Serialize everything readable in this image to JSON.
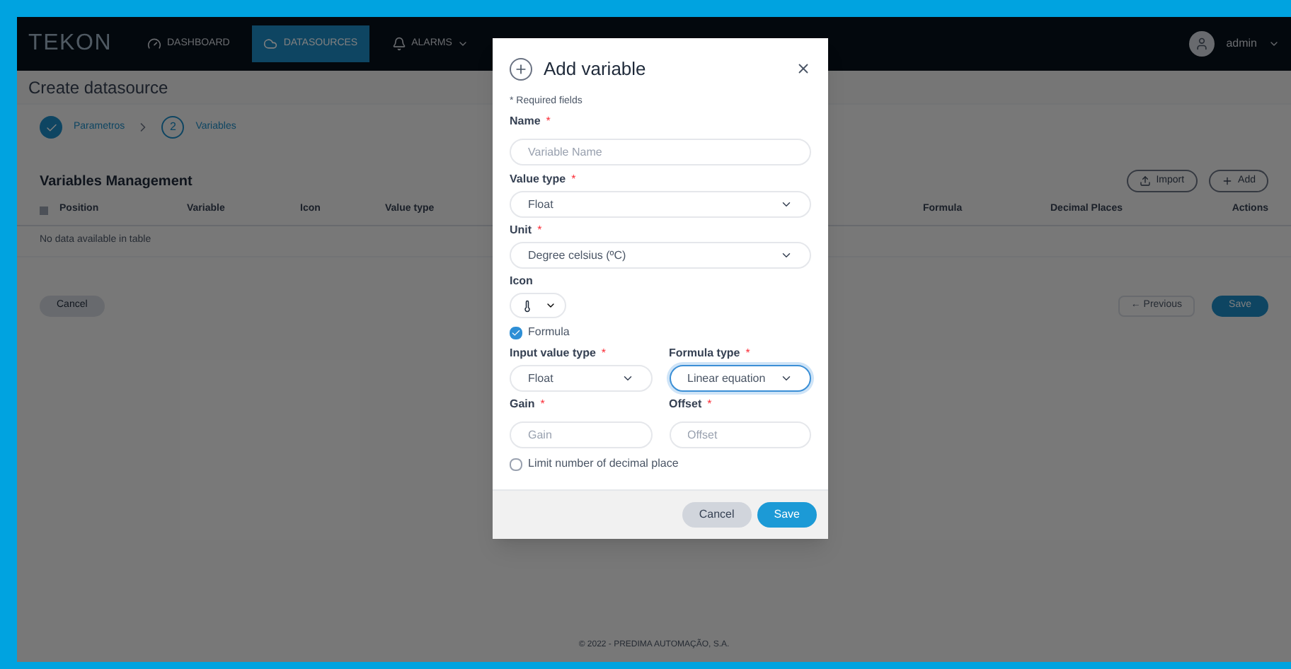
{
  "navbar": {
    "logo": "TEKON",
    "tabs": [
      {
        "label": "DASHBOARD",
        "selected": false,
        "dropdown": false
      },
      {
        "label": "DATASOURCES",
        "selected": true,
        "dropdown": false
      },
      {
        "label": "ALARMS",
        "selected": false,
        "dropdown": true
      }
    ],
    "user": "admin"
  },
  "page": {
    "title": "Create datasource",
    "steps": [
      {
        "label": "Parametros",
        "done": true
      },
      {
        "label": "Variables",
        "number": "2",
        "done": false
      }
    ],
    "section_title": "Variables Management",
    "actions": [
      {
        "label": "Import"
      },
      {
        "label": "Add"
      }
    ],
    "table": {
      "columns": [
        "Position",
        "Variable",
        "Icon",
        "Value type",
        "Formula",
        "Decimal Places",
        "Actions"
      ],
      "empty_text": "No data available in table"
    },
    "cancel": "Cancel",
    "previous": "← Previous",
    "save": "Save"
  },
  "footer": "© 2022 - PREDIMA AUTOMAÇÃO, S.A.",
  "modal": {
    "title": "Add variable",
    "required_note": "* Required fields",
    "name": {
      "label": "Name",
      "mark": "*",
      "placeholder": "Variable Name"
    },
    "value_type": {
      "label": "Value type",
      "mark": "*",
      "value": "Float",
      "focused": false
    },
    "unit": {
      "label": "Unit",
      "mark": "*",
      "value": "Degree celsius (ºC)",
      "focused": false
    },
    "icon": {
      "label": "Icon"
    },
    "formula": {
      "label": "Formula",
      "checked": true
    },
    "input_value_type": {
      "label": "Input value type",
      "mark": "*",
      "value": "Float",
      "focused": false
    },
    "formula_type": {
      "label": "Formula type",
      "mark": "*",
      "value": "Linear equation",
      "focused": true
    },
    "gain": {
      "label": "Gain",
      "mark": "*",
      "placeholder": "Gain"
    },
    "offset": {
      "label": "Offset",
      "mark": "*",
      "placeholder": "Offset"
    },
    "limit_decimals": {
      "label": "Limit number of decimal place",
      "checked": false
    },
    "cancel": "Cancel",
    "save": "Save"
  }
}
